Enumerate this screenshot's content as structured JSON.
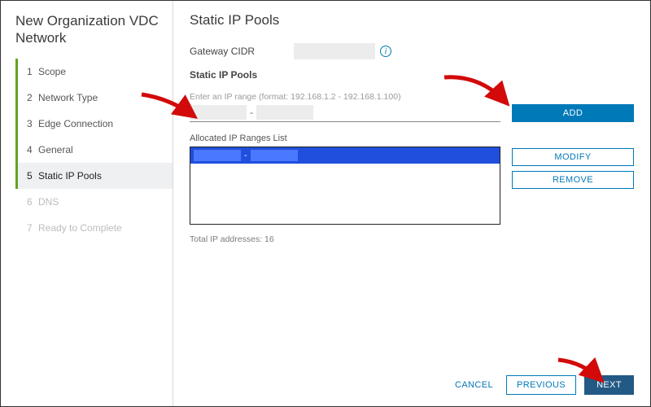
{
  "sidebar": {
    "title": "New Organization VDC Network",
    "steps": [
      {
        "num": "1",
        "label": "Scope",
        "state": "done"
      },
      {
        "num": "2",
        "label": "Network Type",
        "state": "done"
      },
      {
        "num": "3",
        "label": "Edge Connection",
        "state": "done"
      },
      {
        "num": "4",
        "label": "General",
        "state": "done"
      },
      {
        "num": "5",
        "label": "Static IP Pools",
        "state": "active"
      },
      {
        "num": "6",
        "label": "DNS",
        "state": "disabled"
      },
      {
        "num": "7",
        "label": "Ready to Complete",
        "state": "disabled"
      }
    ]
  },
  "page": {
    "title": "Static IP Pools",
    "gateway_label": "Gateway CIDR",
    "gateway_value": "",
    "pools_label": "Static IP Pools",
    "hint": "Enter an IP range (format: 192.168.1.2 - 192.168.1.100)",
    "range_start": "",
    "range_end": "",
    "dash": "-",
    "add_label": "ADD",
    "modify_label": "MODIFY",
    "remove_label": "REMOVE",
    "list_label": "Allocated IP Ranges List",
    "total_label": "Total IP addresses: 16"
  },
  "footer": {
    "cancel": "CANCEL",
    "previous": "PREVIOUS",
    "next": "NEXT"
  },
  "icons": {
    "info": "i"
  }
}
